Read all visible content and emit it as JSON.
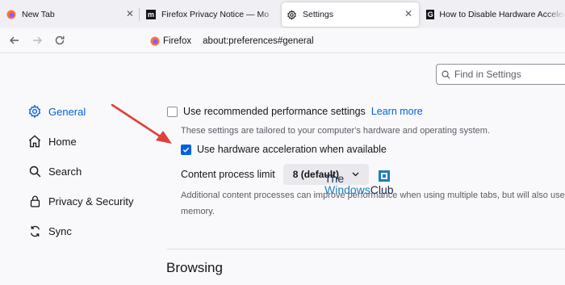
{
  "tabs": [
    {
      "title": "New Tab",
      "icon": "firefox-icon",
      "active": false
    },
    {
      "title": "Firefox Privacy Notice — Mozilla",
      "icon": "mozilla-m-icon",
      "active": false
    },
    {
      "title": "Settings",
      "icon": "gear-icon",
      "active": true
    },
    {
      "title": "How to Disable Hardware Acceleration",
      "icon": "g-icon",
      "active": false
    }
  ],
  "toolbar": {
    "identity_label": "Firefox",
    "url": "about:preferences#general"
  },
  "search": {
    "placeholder": "Find in Settings"
  },
  "sidebar": {
    "items": [
      {
        "label": "General",
        "icon": "gear-icon",
        "selected": true
      },
      {
        "label": "Home",
        "icon": "home-icon",
        "selected": false
      },
      {
        "label": "Search",
        "icon": "search-icon",
        "selected": false
      },
      {
        "label": "Privacy & Security",
        "icon": "lock-icon",
        "selected": false
      },
      {
        "label": "Sync",
        "icon": "sync-icon",
        "selected": false
      }
    ]
  },
  "performance": {
    "recommended_label": "Use recommended performance settings",
    "recommended_checked": false,
    "learn_more": "Learn more",
    "recommended_desc": "These settings are tailored to your computer's hardware and operating system.",
    "hw_accel_label": "Use hardware acceleration when available",
    "hw_accel_checked": true,
    "content_process_label": "Content process limit",
    "content_process_value": "8 (default)",
    "content_process_desc_1": "Additional content processes can improve performance when using multiple tabs, but will also use more",
    "content_process_desc_2": "memory."
  },
  "sections": {
    "browsing_title": "Browsing"
  },
  "watermark": {
    "line1": "The",
    "line2_a": "Windows",
    "line2_b": "Club"
  },
  "colors": {
    "accent": "#0061e0",
    "arrow": "#e0403a"
  }
}
